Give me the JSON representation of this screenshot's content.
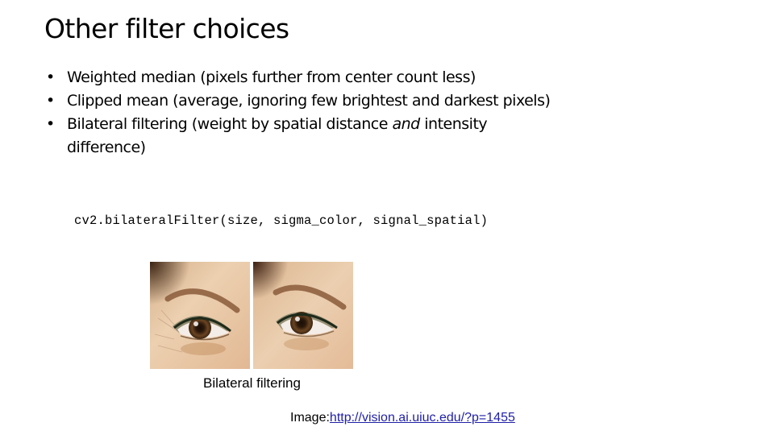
{
  "slide": {
    "title": "Other filter choices",
    "bullets": [
      {
        "text": "Weighted median (pixels further from center count less)"
      },
      {
        "text": "Clipped mean (average, ignoring few brightest and darkest pixels)"
      },
      {
        "text_before": "Bilateral filtering (weight by spatial distance ",
        "emphasis": "and",
        "text_after": " intensity difference)"
      }
    ],
    "bullet_glyph": "•",
    "code": "cv2.bilateralFilter(size, sigma_color, signal_spatial)",
    "figure": {
      "images": [
        {
          "name": "original eye photo",
          "description": "Close-up of eye with visible skin wrinkles (before filtering)"
        },
        {
          "name": "filtered eye photo",
          "description": "Same eye after bilateral filtering, smoothed skin"
        }
      ],
      "caption": "Bilateral filtering"
    },
    "credit": {
      "label": "Image:",
      "link_text": "http://vision.ai.uiuc.edu/?p=1455"
    },
    "colors": {
      "link": "#1f1fa8",
      "skin": "#e2bf9c",
      "brow": "#8a5a3a",
      "iris": "#4a2e18"
    }
  }
}
